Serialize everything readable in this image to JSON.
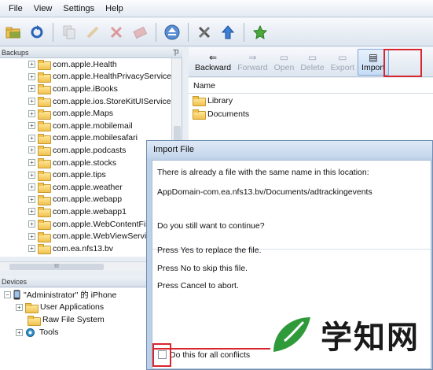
{
  "menu": [
    "File",
    "View",
    "Settings",
    "Help"
  ],
  "toolbar_icons": [
    "open-folder-icon",
    "refresh-icon",
    "copy-icon",
    "clean-icon",
    "delete-icon",
    "erase-icon",
    "eject-icon",
    "tools-icon",
    "upload-icon",
    "star-icon"
  ],
  "backups_pane": {
    "title": "Backups",
    "pin": "ㄗ",
    "items": [
      "com.apple.Health",
      "com.apple.HealthPrivacyService",
      "com.apple.iBooks",
      "com.apple.ios.StoreKitUIService",
      "com.apple.Maps",
      "com.apple.mobilemail",
      "com.apple.mobilesafari",
      "com.apple.podcasts",
      "com.apple.stocks",
      "com.apple.tips",
      "com.apple.weather",
      "com.apple.webapp",
      "com.apple.webapp1",
      "com.apple.WebContentFilte",
      "com.apple.WebViewService",
      "com.ea.nfs13.bv"
    ],
    "hscroll_grip": "III"
  },
  "devices_pane": {
    "title": "Devices",
    "device_name": "\"Administrator\" 的 iPhone",
    "children": [
      "User Applications",
      "Raw File System",
      "Tools"
    ]
  },
  "right_toolbar": {
    "buttons": [
      {
        "label": "Backward",
        "icon": "⇐",
        "state": "enabled"
      },
      {
        "label": "Forward",
        "icon": "⇒",
        "state": "disabled"
      },
      {
        "label": "Open",
        "icon": "▭",
        "state": "disabled"
      },
      {
        "label": "Delete",
        "icon": "▭",
        "state": "disabled"
      },
      {
        "label": "Export",
        "icon": "▭",
        "state": "disabled"
      },
      {
        "label": "Import",
        "icon": "▤",
        "state": "active"
      }
    ]
  },
  "files": {
    "column_header": "Name",
    "rows": [
      "Library",
      "Documents"
    ]
  },
  "dialog": {
    "title": "Import File",
    "line1": "There is already a file with the same name in this location:",
    "path": "AppDomain-com.ea.nfs13.bv/Documents/adtrackingevents",
    "question": "Do you still want to continue?",
    "opt_yes": "Press Yes to replace the file.",
    "opt_no": "Press No to skip this file.",
    "opt_cancel": "Press Cancel to abort.",
    "checkbox_label": "Do this for all conflicts"
  },
  "watermark": {
    "text": "学知网"
  },
  "colors": {
    "highlight_red": "#d8262e",
    "accent_blue": "#3a7bd5"
  }
}
